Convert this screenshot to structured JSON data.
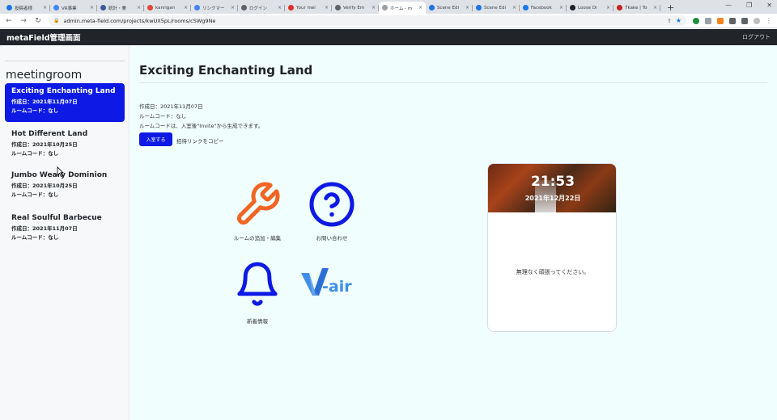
{
  "browser": {
    "tabs": [
      {
        "label": "投稿者様",
        "color": "#1a73e8"
      },
      {
        "label": "VR事業",
        "color": "#4285f4"
      },
      {
        "label": "統計・兼",
        "color": "#3c5a99"
      },
      {
        "label": "kanrigan",
        "color": "#e8453c"
      },
      {
        "label": "リンクマー",
        "color": "#4285f4"
      },
      {
        "label": "ログイン",
        "color": "#5f6368"
      },
      {
        "label": "Your mel",
        "color": "#d93025"
      },
      {
        "label": "Verify Em",
        "color": "#5f6368"
      },
      {
        "label": "ホーム - m",
        "color": "#9aa0a6"
      },
      {
        "label": "Scene Edi",
        "color": "#1a73e8"
      },
      {
        "label": "Scene Edi",
        "color": "#1a73e8"
      },
      {
        "label": "Facebook",
        "color": "#1877f2"
      },
      {
        "label": "Loose Di",
        "color": "#202124"
      },
      {
        "label": "7kake | To",
        "color": "#c5221f"
      }
    ],
    "active_tab_index": 8,
    "url": "admin.meta-field.com/projects/kwUX5pL/rooms/cSWg9Ne"
  },
  "app": {
    "title": "metaField管理画面",
    "logout_label": "ログアウト"
  },
  "sidebar": {
    "title": "meetingroom",
    "rooms": [
      {
        "name": "Exciting Enchanting Land",
        "created": "作成日：2021年11月07日",
        "code": "ルームコード：なし"
      },
      {
        "name": "Hot Different Land",
        "created": "作成日：2021年10月25日",
        "code": "ルームコード：なし"
      },
      {
        "name": "Jumbo Weary Dominion",
        "created": "作成日：2021年10月25日",
        "code": "ルームコード：なし"
      },
      {
        "name": "Real Soulful Barbecue",
        "created": "作成日：2021年11月07日",
        "code": "ルームコード：なし"
      }
    ]
  },
  "main": {
    "title": "Exciting Enchanting Land",
    "created": "作成日：2021年11月07日",
    "room_code": "ルームコード：なし",
    "code_note": "ルームコードは、入室後\"Invite\"から生成できます。",
    "enter_button": "入室する",
    "copy_invite": "招待リンクをコピー",
    "tiles": {
      "edit_label": "ルームの追加・編集",
      "contact_label": "お問い合わせ",
      "news_label": "新着情報",
      "vair_text": "-air"
    },
    "colors": {
      "accent": "#0d1ae6",
      "wrench": "#f26522",
      "vair": "#3d8ee8"
    }
  },
  "widget": {
    "time": "21:53",
    "date": "2021年12月22日",
    "message": "無理なく頑張ってください。"
  }
}
